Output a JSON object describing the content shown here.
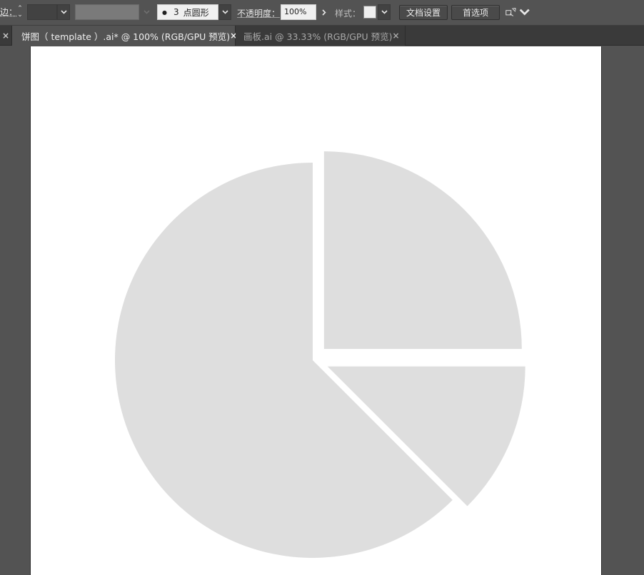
{
  "control_bar": {
    "stroke_label": "边：",
    "stroke_value": "",
    "variable_width_profile": "",
    "brush_size": "3",
    "brush_name": "点圆形",
    "opacity_label": "不透明度：",
    "opacity_value": "100%",
    "style_label": "样式：",
    "document_setup_button": "文档设置",
    "preferences_button": "首选项"
  },
  "tabs": [
    {
      "title": "饼图（ template ）.ai* @ 100% (RGB/GPU 预览)",
      "active": true,
      "close": "×"
    },
    {
      "title": "画板.ai @ 33.33% (RGB/GPU 预览)",
      "active": false,
      "close": "×"
    }
  ],
  "prev_tab_close": "×",
  "chart_data": {
    "type": "pie",
    "values": [
      62.5,
      25,
      12.5
    ],
    "colors": [
      "#dedede",
      "#dedede",
      "#dedede"
    ],
    "exploded": true,
    "title": "",
    "legend": "none"
  },
  "colors": {
    "ui_background": "#535353",
    "tab_bar": "#3a3a3a",
    "artboard": "#ffffff",
    "pie_fill": "#dedede"
  }
}
